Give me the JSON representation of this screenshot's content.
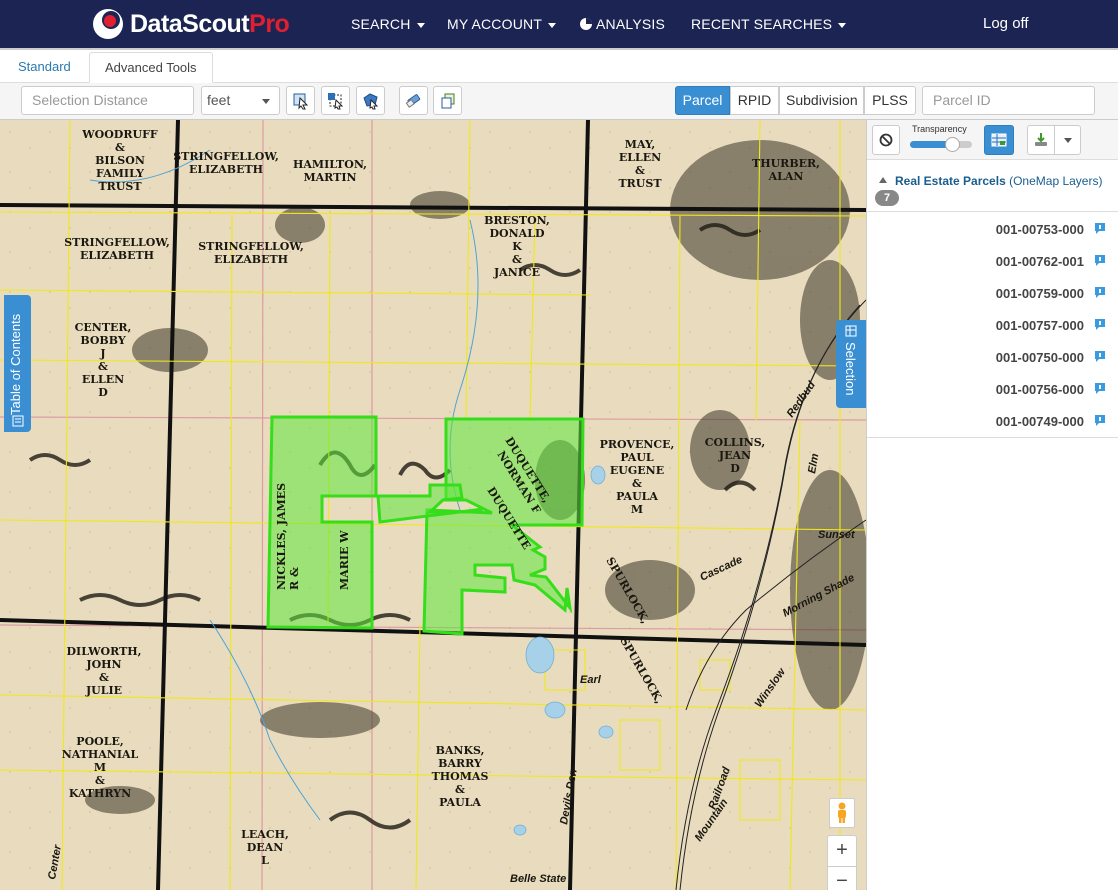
{
  "app": {
    "brand_main": "DataScout",
    "brand_accent": "Pro",
    "brand_accent_color": "#e0202f",
    "nav_bg": "#1b2452"
  },
  "nav": {
    "items": [
      {
        "label": "SEARCH",
        "has_caret": true
      },
      {
        "label": "MY ACCOUNT",
        "has_caret": true
      },
      {
        "label": "ANALYSIS",
        "icon": "pie-chart-icon"
      },
      {
        "label": "RECENT SEARCHES",
        "has_caret": true
      }
    ],
    "logoff": "Log off"
  },
  "tabs": {
    "standard": "Standard",
    "advanced": "Advanced Tools",
    "active": "Advanced Tools"
  },
  "toolbar": {
    "selection_distance_placeholder": "Selection Distance",
    "units_value": "feet",
    "tool_icons": [
      "select-parcel-icon",
      "select-box-icon",
      "select-polygon-icon",
      "clear-selection-icon",
      "copy-icon"
    ],
    "search_types": [
      "Parcel",
      "RPID",
      "Subdivision",
      "PLSS"
    ],
    "active_search_type": "Parcel",
    "parcel_id_placeholder": "Parcel ID"
  },
  "map": {
    "toc_label": "Table of Contents",
    "selection_label": "Selection",
    "zoom_in": "+",
    "zoom_out": "−",
    "owner_labels": [
      "WOODRUFF & BILSON FAMILY TRUST",
      "STRINGFELLOW, ELIZABETH",
      "HAMILTON, MARTIN",
      "BRESTON, DONALD K & JANICE",
      "MAY, ELLEN TRUST",
      "THURBER, ALAN",
      "CENTER, BOBBY J & ELLEN D",
      "DUQUETTE, NORMAN F & DUQUETTE",
      "PROVENCE, PAUL EUGENE & PAULA M",
      "COLLINS, JEAN D",
      "NICKLES, JAMES R & MARIE W",
      "SPURLOCK, JERRY",
      "DILWORTH, JOHN & JULIE",
      "POOLE, NATHANIAL M & KATHRYN",
      "BANKS, BARRY THOMAS & PAULA",
      "LEACH, DEAN L"
    ],
    "road_labels": [
      "Earl",
      "Devils Den",
      "Belle State",
      "Sunset",
      "Cascade",
      "Morning Shade",
      "Redbud",
      "Railroad",
      "Mountain",
      "Winslow",
      "Elm",
      "Center"
    ],
    "selection_color": "#4ee030"
  },
  "panel": {
    "transparency_label": "Transparency",
    "transparency_value": 0.75,
    "layer_name": "Real Estate Parcels",
    "layer_group": "(OneMap Layers)",
    "count": "7",
    "parcels": [
      "001-00753-000",
      "001-00762-001",
      "001-00759-000",
      "001-00757-000",
      "001-00750-000",
      "001-00756-000",
      "001-00749-000"
    ]
  }
}
